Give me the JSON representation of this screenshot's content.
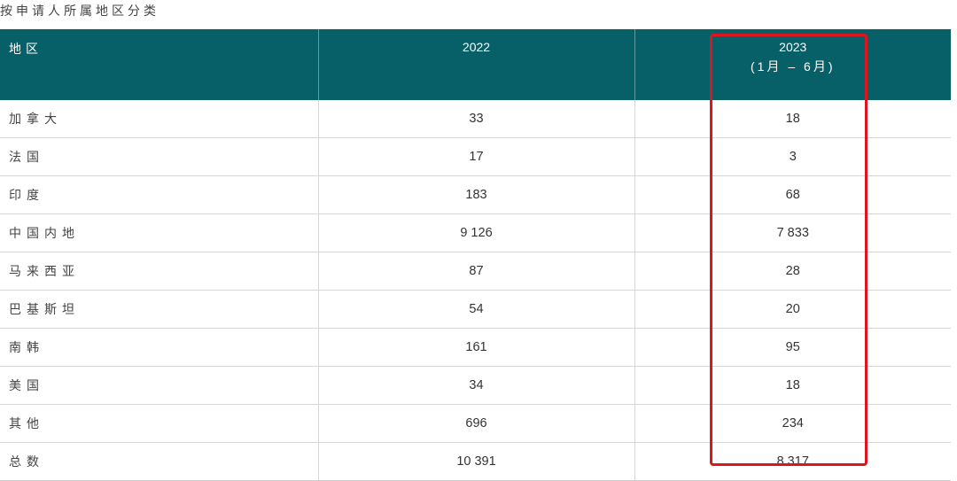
{
  "caption": "按申请人所属地区分类",
  "table": {
    "headers": {
      "region": "地区",
      "year1": "2022",
      "year2": "2023",
      "year2_sub": "(1月 – 6月)"
    },
    "rows": [
      {
        "region": "加拿大",
        "y2022": "33",
        "y2023": "18"
      },
      {
        "region": "法国",
        "y2022": "17",
        "y2023": "3"
      },
      {
        "region": "印度",
        "y2022": "183",
        "y2023": "68"
      },
      {
        "region": "中国内地",
        "y2022": "9 126",
        "y2023": "7 833"
      },
      {
        "region": "马来西亚",
        "y2022": "87",
        "y2023": "28"
      },
      {
        "region": "巴基斯坦",
        "y2022": "54",
        "y2023": "20"
      },
      {
        "region": "南韩",
        "y2022": "161",
        "y2023": "95"
      },
      {
        "region": "美国",
        "y2022": "34",
        "y2023": "18"
      },
      {
        "region": "其他",
        "y2022": "696",
        "y2023": "234"
      },
      {
        "region": "总数",
        "y2022": "10 391",
        "y2023": "8 317"
      }
    ]
  },
  "colors": {
    "header_bg": "#075f67",
    "highlight": "#e0141e"
  }
}
